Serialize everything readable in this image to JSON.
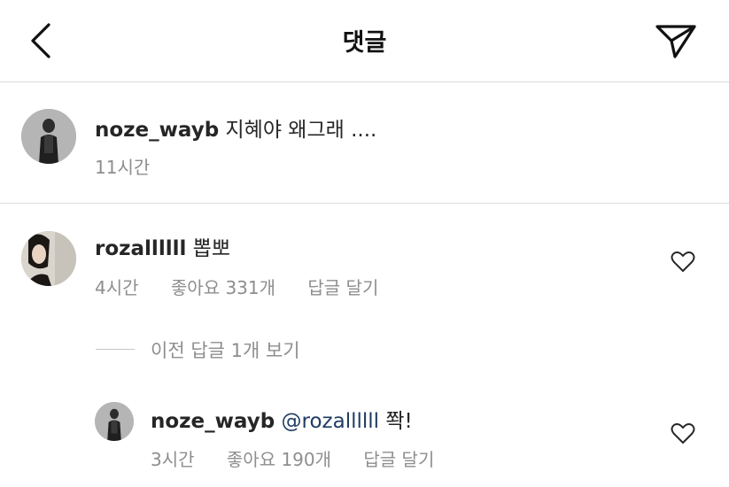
{
  "header": {
    "title": "댓글",
    "back_icon": "chevron-left-icon",
    "send_icon": "paper-plane-icon"
  },
  "caption": {
    "username": "noze_wayb",
    "text": "지혜야 왜그래 ....",
    "time": "11시간"
  },
  "comments": [
    {
      "username": "rozallllll",
      "text": "뽑뽀",
      "time": "4시간",
      "likes": "좋아요 331개",
      "reply_label": "답글 달기"
    }
  ],
  "view_previous_replies": "이전 답글 1개 보기",
  "replies": [
    {
      "username": "noze_wayb",
      "mention": "@rozallllll",
      "text": "쫙!",
      "time": "3시간",
      "likes": "좋아요 190개",
      "reply_label": "답글 달기"
    }
  ],
  "colors": {
    "text": "#262626",
    "secondary": "#8e8e8e",
    "mention": "#1f3c63",
    "divider": "#dbdbdb"
  }
}
